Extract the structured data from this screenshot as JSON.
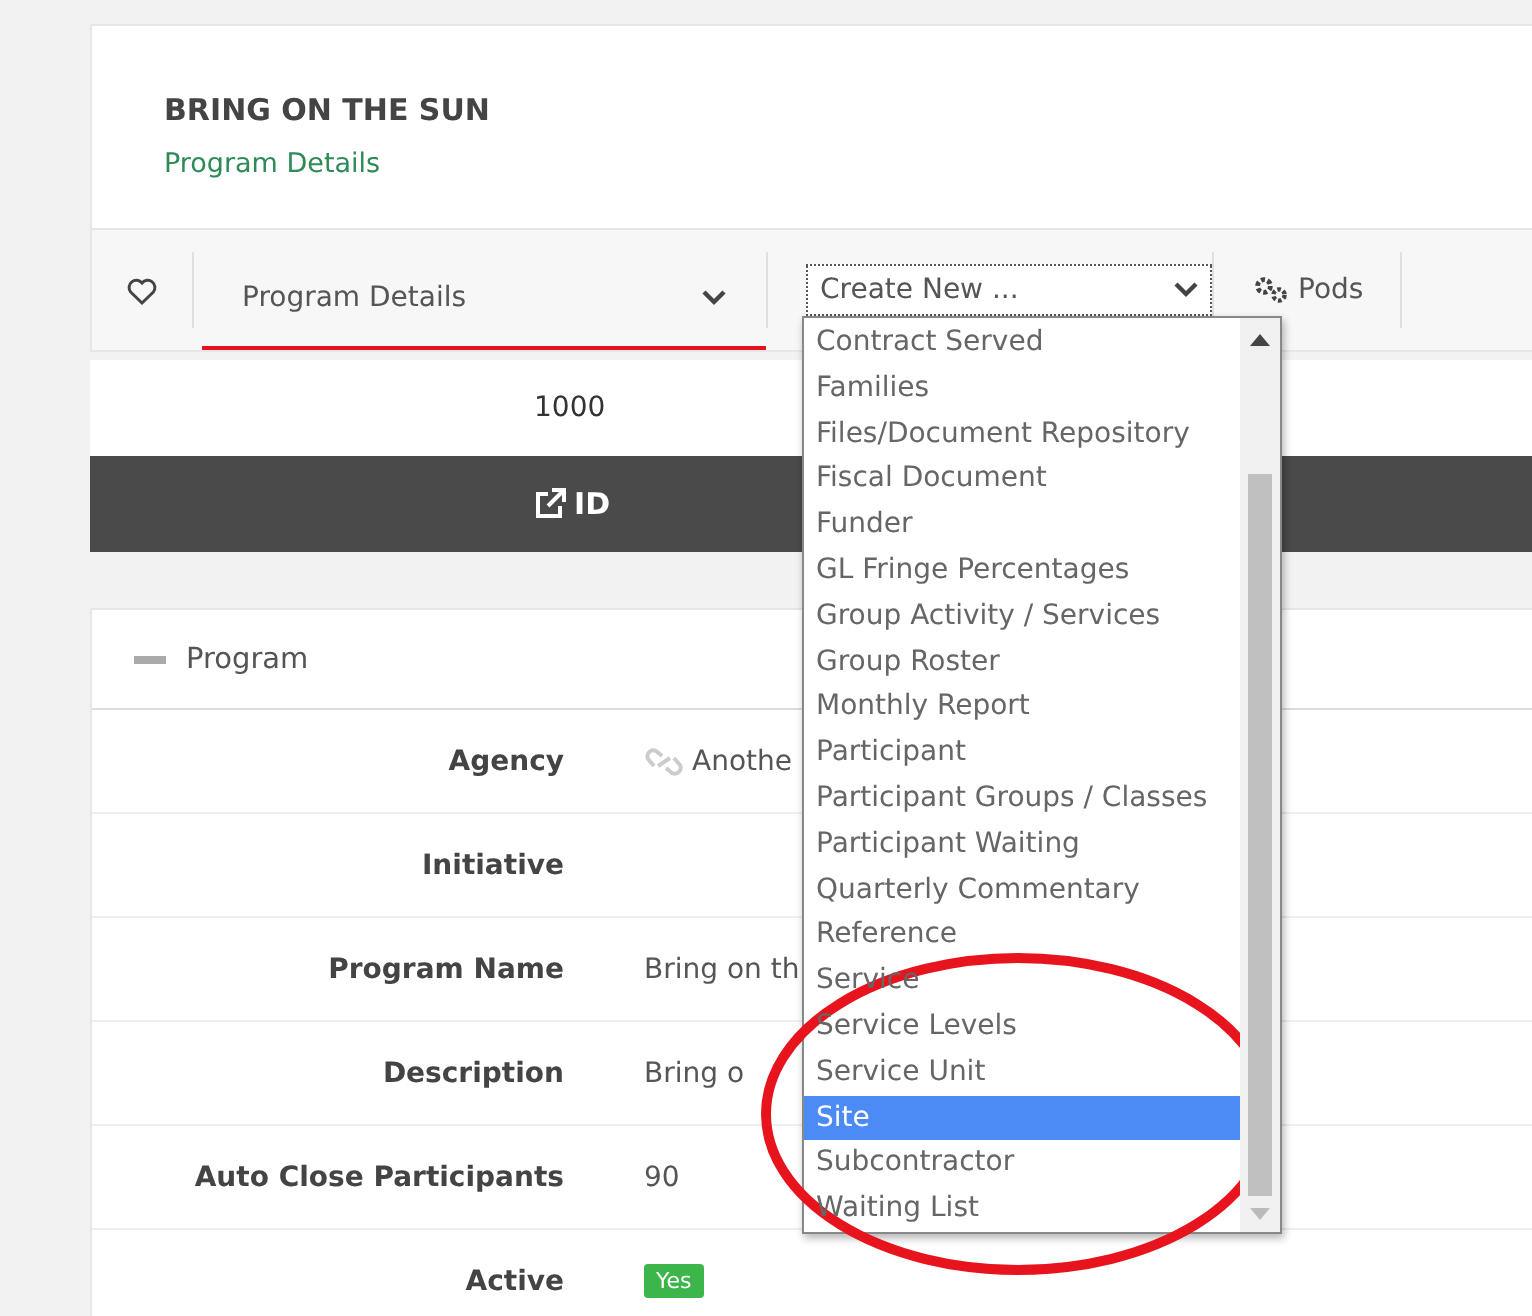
{
  "header": {
    "title": "BRING ON THE SUN",
    "subtitle": "Program Details"
  },
  "toolbar": {
    "favorite": false,
    "view_select": {
      "value": "Program Details",
      "selected": true
    },
    "create_select": {
      "value": "Create New ..."
    },
    "pods": "Pods"
  },
  "summary": {
    "value": "1000",
    "button": "ID"
  },
  "program_panel": {
    "title": "Program",
    "expanded": true,
    "rows": [
      {
        "label": "Agency",
        "value": "Anothe",
        "linked": true
      },
      {
        "label": "Initiative",
        "value": ""
      },
      {
        "label": "Program Name",
        "value": "Bring on th"
      },
      {
        "label": "Description",
        "value": "Bring o"
      },
      {
        "label": "Auto Close Participants",
        "value": "90"
      },
      {
        "label": "Active",
        "badge": "Yes"
      }
    ]
  },
  "create_menu": {
    "items": [
      {
        "label": "Contract Served",
        "selected": false
      },
      {
        "label": "Families",
        "selected": false
      },
      {
        "label": "Files/Document Repository",
        "selected": false
      },
      {
        "label": "Fiscal Document",
        "selected": false
      },
      {
        "label": "Funder",
        "selected": false
      },
      {
        "label": "GL Fringe Percentages",
        "selected": false
      },
      {
        "label": "Group Activity / Services",
        "selected": false
      },
      {
        "label": "Group Roster",
        "selected": false
      },
      {
        "label": "Monthly Report",
        "selected": false
      },
      {
        "label": "Participant",
        "selected": false
      },
      {
        "label": "Participant Groups / Classes",
        "selected": false
      },
      {
        "label": "Participant Waiting",
        "selected": false
      },
      {
        "label": "Quarterly Commentary",
        "selected": false
      },
      {
        "label": "Reference",
        "selected": false
      },
      {
        "label": "Service",
        "selected": false
      },
      {
        "label": "Service Levels",
        "selected": false
      },
      {
        "label": "Service Unit",
        "selected": false
      },
      {
        "label": "Site",
        "selected": true
      },
      {
        "label": "Subcontractor",
        "selected": false
      },
      {
        "label": "Waiting List",
        "selected": false
      }
    ]
  }
}
